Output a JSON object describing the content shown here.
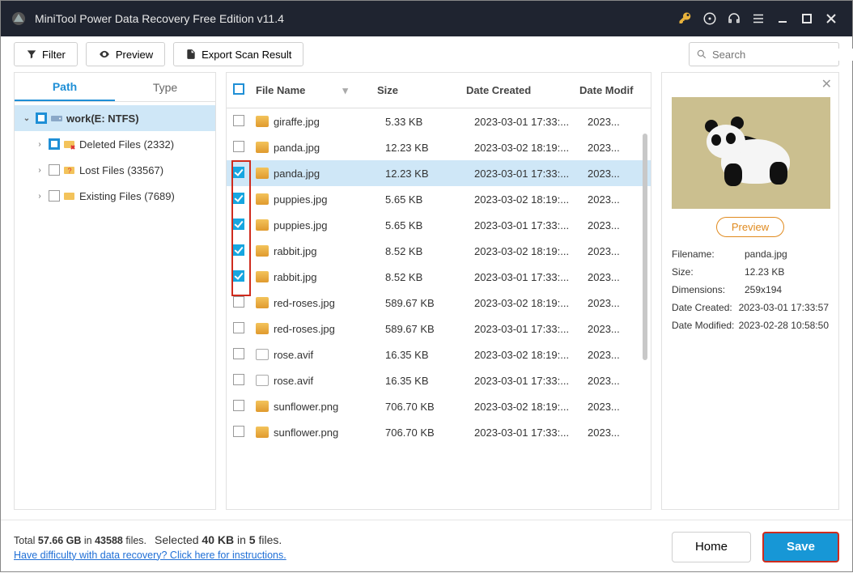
{
  "titlebar": {
    "title": "MiniTool Power Data Recovery Free Edition v11.4"
  },
  "toolbar": {
    "filter": "Filter",
    "preview": "Preview",
    "export": "Export Scan Result",
    "search_placeholder": "Search"
  },
  "sidebar": {
    "tab_path": "Path",
    "tab_type": "Type",
    "root": "work(E: NTFS)",
    "items": [
      {
        "label": "Deleted Files (2332)"
      },
      {
        "label": "Lost Files (33567)"
      },
      {
        "label": "Existing Files (7689)"
      }
    ]
  },
  "table": {
    "col_name": "File Name",
    "col_size": "Size",
    "col_created": "Date Created",
    "col_modif": "Date Modif",
    "rows": [
      {
        "checked": false,
        "sel": false,
        "icon": "img",
        "name": "giraffe.jpg",
        "size": "5.33 KB",
        "created": "2023-03-01 17:33:...",
        "modif": "2023..."
      },
      {
        "checked": false,
        "sel": false,
        "icon": "img",
        "name": "panda.jpg",
        "size": "12.23 KB",
        "created": "2023-03-02 18:19:...",
        "modif": "2023..."
      },
      {
        "checked": true,
        "sel": true,
        "icon": "img",
        "name": "panda.jpg",
        "size": "12.23 KB",
        "created": "2023-03-01 17:33:...",
        "modif": "2023..."
      },
      {
        "checked": true,
        "sel": false,
        "icon": "img",
        "name": "puppies.jpg",
        "size": "5.65 KB",
        "created": "2023-03-02 18:19:...",
        "modif": "2023..."
      },
      {
        "checked": true,
        "sel": false,
        "icon": "img",
        "name": "puppies.jpg",
        "size": "5.65 KB",
        "created": "2023-03-01 17:33:...",
        "modif": "2023..."
      },
      {
        "checked": true,
        "sel": false,
        "icon": "img",
        "name": "rabbit.jpg",
        "size": "8.52 KB",
        "created": "2023-03-02 18:19:...",
        "modif": "2023..."
      },
      {
        "checked": true,
        "sel": false,
        "icon": "img",
        "name": "rabbit.jpg",
        "size": "8.52 KB",
        "created": "2023-03-01 17:33:...",
        "modif": "2023..."
      },
      {
        "checked": false,
        "sel": false,
        "icon": "img",
        "name": "red-roses.jpg",
        "size": "589.67 KB",
        "created": "2023-03-02 18:19:...",
        "modif": "2023..."
      },
      {
        "checked": false,
        "sel": false,
        "icon": "img",
        "name": "red-roses.jpg",
        "size": "589.67 KB",
        "created": "2023-03-01 17:33:...",
        "modif": "2023..."
      },
      {
        "checked": false,
        "sel": false,
        "icon": "doc",
        "name": "rose.avif",
        "size": "16.35 KB",
        "created": "2023-03-02 18:19:...",
        "modif": "2023..."
      },
      {
        "checked": false,
        "sel": false,
        "icon": "doc",
        "name": "rose.avif",
        "size": "16.35 KB",
        "created": "2023-03-01 17:33:...",
        "modif": "2023..."
      },
      {
        "checked": false,
        "sel": false,
        "icon": "img",
        "name": "sunflower.png",
        "size": "706.70 KB",
        "created": "2023-03-02 18:19:...",
        "modif": "2023..."
      },
      {
        "checked": false,
        "sel": false,
        "icon": "img",
        "name": "sunflower.png",
        "size": "706.70 KB",
        "created": "2023-03-01 17:33:...",
        "modif": "2023..."
      }
    ]
  },
  "preview": {
    "button": "Preview",
    "meta": {
      "filename_k": "Filename:",
      "filename_v": "panda.jpg",
      "size_k": "Size:",
      "size_v": "12.23 KB",
      "dim_k": "Dimensions:",
      "dim_v": "259x194",
      "created_k": "Date Created:",
      "created_v": "2023-03-01 17:33:57",
      "modified_k": "Date Modified:",
      "modified_v": "2023-02-28 10:58:50"
    }
  },
  "footer": {
    "total_pre": "Total ",
    "total_size": "57.66 GB",
    "total_mid": " in ",
    "total_files": "43588",
    "total_post": " files.",
    "sel_pre": "Selected ",
    "sel_size": "40 KB",
    "sel_mid": " in ",
    "sel_count": "5",
    "sel_post": " files.",
    "help_link": "Have difficulty with data recovery? Click here for instructions.",
    "home": "Home",
    "save": "Save"
  }
}
